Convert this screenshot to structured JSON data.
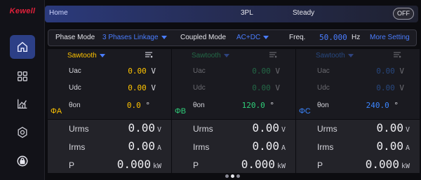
{
  "brand": "Kewell",
  "topbar": {
    "home": "Home",
    "mode": "3PL",
    "state": "Steady",
    "output_toggle": "OFF"
  },
  "nav": [
    {
      "icon": "home-icon",
      "active": true
    },
    {
      "icon": "grid-icon",
      "active": false
    },
    {
      "icon": "chart-icon",
      "active": false
    },
    {
      "icon": "settings-icon",
      "active": false
    },
    {
      "icon": "lock-icon",
      "active": false
    }
  ],
  "settings": {
    "phase_mode_label": "Phase Mode",
    "phase_mode_value": "3 Phases Linkage",
    "coupled_mode_label": "Coupled Mode",
    "coupled_mode_value": "AC+DC",
    "freq_label": "Freq.",
    "freq_value": "50.000",
    "freq_unit": "Hz",
    "more_setting": "More Setting"
  },
  "phases": [
    {
      "name": "ΦA",
      "waveform": "Sawtooth",
      "color": "#ffc400",
      "dim": false,
      "uac_label": "Uac",
      "uac": "0.00",
      "uac_unit": "V",
      "udc_label": "Udc",
      "udc": "0.00",
      "udc_unit": "V",
      "theta_label": "θon",
      "theta": "0.0",
      "theta_unit": "°",
      "urms_label": "Urms",
      "urms": "0.00",
      "urms_unit": "V",
      "irms_label": "Irms",
      "irms": "0.00",
      "irms_unit": "A",
      "p_label": "P",
      "p": "0.000",
      "p_unit": "kW"
    },
    {
      "name": "ΦB",
      "waveform": "Sawtooth",
      "color": "#2fd07a",
      "dim": true,
      "uac_label": "Uac",
      "uac": "0.00",
      "uac_unit": "V",
      "udc_label": "Udc",
      "udc": "0.00",
      "udc_unit": "V",
      "theta_label": "θon",
      "theta": "120.0",
      "theta_unit": "°",
      "urms_label": "Urms",
      "urms": "0.00",
      "urms_unit": "V",
      "irms_label": "Irms",
      "irms": "0.00",
      "irms_unit": "A",
      "p_label": "P",
      "p": "0.000",
      "p_unit": "kW"
    },
    {
      "name": "ΦC",
      "waveform": "Sawtooth",
      "color": "#3b86ff",
      "dim": true,
      "uac_label": "Uac",
      "uac": "0.00",
      "uac_unit": "V",
      "udc_label": "Udc",
      "udc": "0.00",
      "udc_unit": "V",
      "theta_label": "θon",
      "theta": "240.0",
      "theta_unit": "°",
      "urms_label": "Urms",
      "urms": "0.00",
      "urms_unit": "V",
      "irms_label": "Irms",
      "irms": "0.00",
      "irms_unit": "A",
      "p_label": "P",
      "p": "0.000",
      "p_unit": "kW"
    }
  ],
  "pagination": {
    "pages": 3,
    "current": 2
  }
}
